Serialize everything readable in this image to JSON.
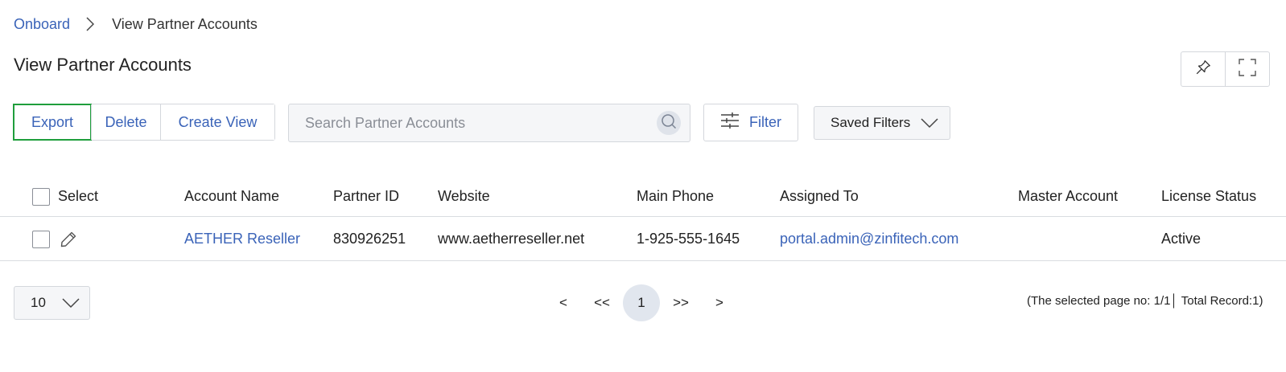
{
  "breadcrumb": {
    "parent": "Onboard",
    "current": "View Partner Accounts"
  },
  "page": {
    "title": "View Partner Accounts"
  },
  "toolbar": {
    "export_label": "Export",
    "delete_label": "Delete",
    "create_view_label": "Create View",
    "filter_label": "Filter",
    "saved_filters_label": "Saved Filters"
  },
  "search": {
    "placeholder": "Search Partner Accounts",
    "value": ""
  },
  "table": {
    "columns": [
      "Select",
      "Account Name",
      "Partner ID",
      "Website",
      "Main Phone",
      "Assigned To",
      "Master Account",
      "License Status"
    ],
    "rows": [
      {
        "account_name": "AETHER Reseller",
        "partner_id": "830926251",
        "website": "www.aetherreseller.net",
        "main_phone": "1-925-555-1645",
        "assigned_to": "portal.admin@zinfitech.com",
        "master_account": "",
        "license_status": "Active"
      }
    ]
  },
  "pagination": {
    "page_size": "10",
    "prev": "<",
    "first": "<<",
    "current_page": "1",
    "last": ">>",
    "next": ">",
    "info": "(The selected page no: 1/1│ Total Record:1)"
  },
  "colors": {
    "link": "#3a63b8",
    "highlight_border": "#1f9e3c",
    "border": "#d4d7dc",
    "input_bg": "#f5f6f8"
  },
  "icons": [
    "chevron-right-icon",
    "pin-icon",
    "fullscreen-icon",
    "search-icon",
    "sliders-icon",
    "chevron-down-icon",
    "pencil-icon"
  ]
}
